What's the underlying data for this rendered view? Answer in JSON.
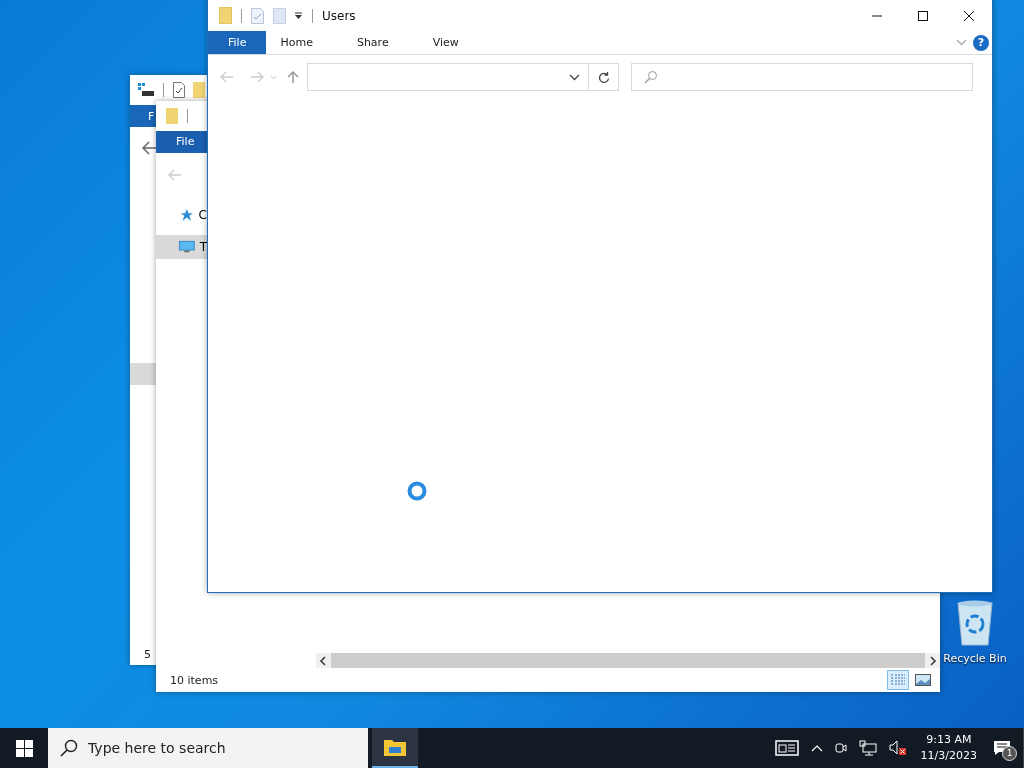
{
  "back_window": {
    "file_tab": "F",
    "selected_row": true,
    "status": "5"
  },
  "middle_window": {
    "file_tab": "File",
    "sidebar": [
      {
        "label": "C",
        "kind": "star",
        "selected": false
      },
      {
        "label": "T",
        "kind": "pc",
        "selected": true
      }
    ],
    "status": "10 items",
    "views": [
      {
        "kind": "details",
        "selected": true
      },
      {
        "kind": "large_icons",
        "selected": false
      }
    ]
  },
  "front_window": {
    "title": "Users",
    "tabs": [
      {
        "label": "File",
        "kind": "file"
      },
      {
        "label": "Home",
        "kind": "tab"
      },
      {
        "label": "Share",
        "kind": "tab"
      },
      {
        "label": "View",
        "kind": "tab"
      }
    ],
    "help": "?",
    "loading": true
  },
  "desktop_icons": [
    {
      "label": "Recycle Bin"
    }
  ],
  "taskbar": {
    "search": {
      "placeholder": "Type here to search"
    },
    "apps": [
      {
        "active": true
      }
    ],
    "time": "9:13 AM",
    "date": "11/3/2023",
    "notifications": "1"
  }
}
